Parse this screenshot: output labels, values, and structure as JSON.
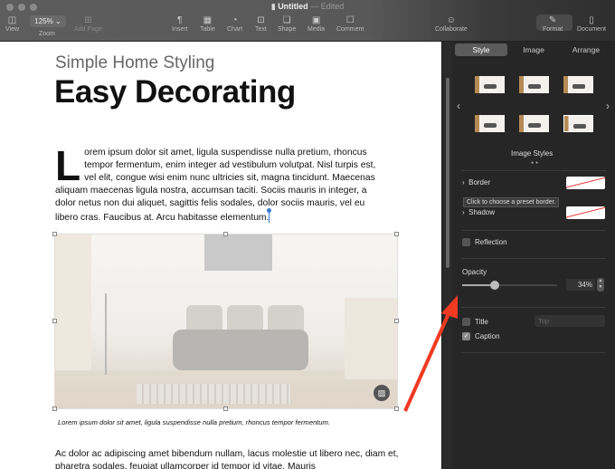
{
  "window": {
    "title": "Untitled",
    "status": "Edited",
    "separator": "—"
  },
  "toolbar": {
    "view": "View",
    "zoom_value": "125% ⌄",
    "zoom": "Zoom",
    "add_page": "Add Page",
    "insert": "Insert",
    "table": "Table",
    "chart": "Chart",
    "text": "Text",
    "shape": "Shape",
    "media": "Media",
    "comment": "Comment",
    "collaborate": "Collaborate",
    "format": "Format",
    "document": "Document"
  },
  "doc": {
    "subtitle": "Simple Home Styling",
    "title": "Easy Decorating",
    "drop_cap": "L",
    "para1": "orem ipsum dolor sit amet, ligula suspendisse nulla pretium, rhoncus tempor fermentum, enim integer ad vestibulum volutpat. Nisl turpis est, vel elit, congue wisi enim nunc ultricies sit, magna tincidunt. Maecenas aliquam maecenas ligula nostra, accumsan taciti. Sociis mauris in integer, a dolor netus non dui aliquet, sagittis felis sodales, dolor sociis mauris, vel eu libero cras. Faucibus at. Arcu habitasse elementum.",
    "caption": "Lorem ipsum dolor sit amet, ligula suspendisse nulla pretium, rhoncus tempor fermentum.",
    "para2": "Ac dolor ac adipiscing amet bibendum nullam, lacus molestie ut libero nec, diam et, pharetra sodales, feugiat ullamcorper id tempor id vitae. Mauris"
  },
  "sidebar": {
    "tabs": [
      "Style",
      "Image",
      "Arrange"
    ],
    "image_styles": "Image Styles",
    "border": "Border",
    "tooltip": "Click to choose a preset border.",
    "shadow": "Shadow",
    "reflection": "Reflection",
    "opacity_label": "Opacity",
    "opacity_value": "34%",
    "opacity": 0.34,
    "title": "Title",
    "title_position": "Top",
    "caption": "Caption",
    "caption_checked": true
  },
  "colors": {
    "accent_arrow": "#f03a22"
  }
}
